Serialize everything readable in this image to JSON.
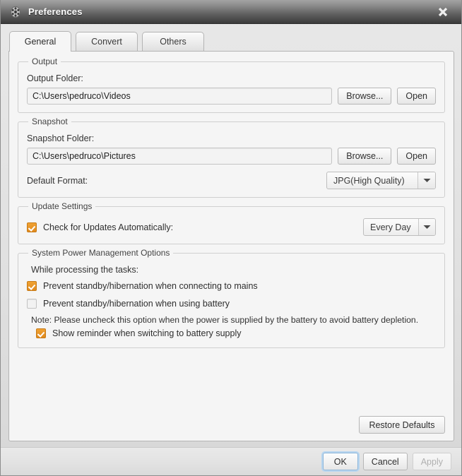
{
  "window": {
    "title": "Preferences",
    "icon": "film-reel-icon",
    "close_icon": "close-icon"
  },
  "tabs": [
    {
      "label": "General",
      "active": true
    },
    {
      "label": "Convert",
      "active": false
    },
    {
      "label": "Others",
      "active": false
    }
  ],
  "groups": {
    "output": {
      "legend": "Output",
      "folder_label": "Output Folder:",
      "folder_value": "C:\\Users\\pedruco\\Videos",
      "browse_label": "Browse...",
      "open_label": "Open"
    },
    "snapshot": {
      "legend": "Snapshot",
      "folder_label": "Snapshot Folder:",
      "folder_value": "C:\\Users\\pedruco\\Pictures",
      "browse_label": "Browse...",
      "open_label": "Open",
      "format_label": "Default Format:",
      "format_value": "JPG(High Quality)"
    },
    "update": {
      "legend": "Update Settings",
      "check_label": "Check for Updates Automatically:",
      "check_checked": true,
      "interval_value": "Every Day"
    },
    "power": {
      "legend": "System Power Management Options",
      "intro": "While processing the tasks:",
      "option_mains_label": "Prevent standby/hibernation when connecting to mains",
      "option_mains_checked": true,
      "option_battery_label": "Prevent standby/hibernation when using battery",
      "option_battery_checked": false,
      "note": "Note: Please uncheck this option when the power is supplied by the battery to avoid battery depletion.",
      "reminder_label": "Show reminder when switching to battery supply",
      "reminder_checked": true
    }
  },
  "actions": {
    "restore_defaults_label": "Restore Defaults",
    "ok_label": "OK",
    "cancel_label": "Cancel",
    "apply_label": "Apply"
  },
  "colors": {
    "checkbox_accent": "#e08a1e",
    "panel_bg": "#f5f5f5",
    "titlebar_dark": "#3b3b3b",
    "focus_ring": "#b8d6f0"
  }
}
